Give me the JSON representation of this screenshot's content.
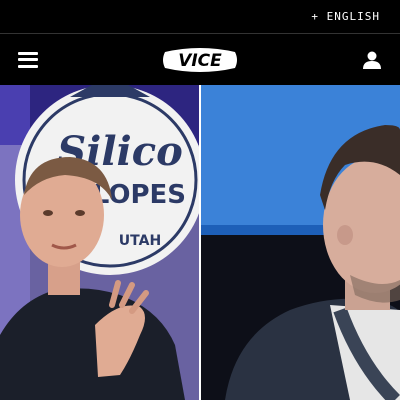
{
  "topbar": {
    "language_label": "+ ENGLISH"
  },
  "navbar": {
    "logo_text": "VICE",
    "menu_icon": "hamburger-menu-icon",
    "account_icon": "user-account-icon"
  },
  "hero": {
    "sign_lines": [
      "Silico",
      "SLOPES",
      "UTAH"
    ]
  },
  "colors": {
    "background": "#000000",
    "text": "#ffffff",
    "left_photo_bg": "#3a2f8f",
    "right_photo_bg": "#1e5fb5"
  }
}
